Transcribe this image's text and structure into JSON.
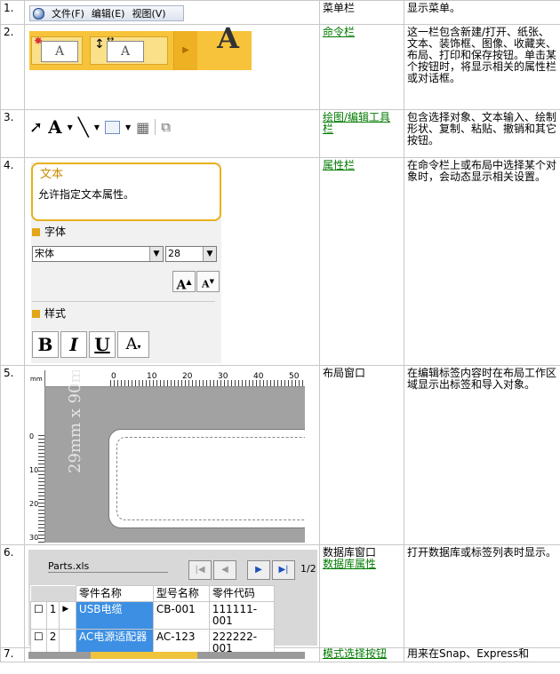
{
  "rows": [
    {
      "num": "1.",
      "name": "菜单栏",
      "name_is_link": false,
      "desc": "显示菜单。",
      "menu": [
        "文件(F)",
        "编辑(E)",
        "视图(V)"
      ]
    },
    {
      "num": "2.",
      "name": "命令栏",
      "name_is_link": true,
      "desc": "这一栏包含新建/打开、纸张、文本、装饰框、图像、收藏夹、布局、打印和保存按钮。单击某个按钮时，将显示相关的属性栏或对话框。"
    },
    {
      "num": "3.",
      "name": "绘图/编辑工具栏",
      "name_is_link": true,
      "desc": "包含选择对象、文本输入、绘制形状、复制、粘贴、撤销和其它按钮。"
    },
    {
      "num": "4.",
      "name": "属性栏",
      "name_is_link": true,
      "desc": "在命令栏上或布局中选择某个对象时，会动态显示相关设置。",
      "panel": {
        "title": "文本",
        "subtitle": "允许指定文本属性。",
        "font_section": "字体",
        "font_value": "宋体",
        "size_value": "28",
        "style_section": "样式"
      }
    },
    {
      "num": "5.",
      "name": "布局窗口",
      "name_is_link": false,
      "desc": "在编辑标签内容时在布局工作区域显示出标签和导入对象。",
      "layout": {
        "unit": "mm",
        "ruler_top": [
          "0",
          "10",
          "20",
          "30",
          "40",
          "50"
        ],
        "ruler_left": [
          "0",
          "10",
          "20",
          "30"
        ],
        "dimension": "29mm x 90mm"
      }
    },
    {
      "num": "6.",
      "name": "数据库窗口",
      "name_link": "数据库属性",
      "name_is_link": false,
      "desc": "打开数据库或标签列表时显示。",
      "database": {
        "file": "Parts.xls",
        "page": "1/2",
        "headers": [
          "零件名称",
          "型号名称",
          "零件代码"
        ],
        "records": [
          [
            "1",
            "USB电缆",
            "CB-001",
            "111111-001"
          ],
          [
            "2",
            "AC电源适配器",
            "AC-123",
            "222222-001"
          ]
        ]
      }
    },
    {
      "num": "7.",
      "name": "模式选择按钮",
      "name_is_link": true,
      "desc": "用来在Snap、Express和"
    }
  ]
}
